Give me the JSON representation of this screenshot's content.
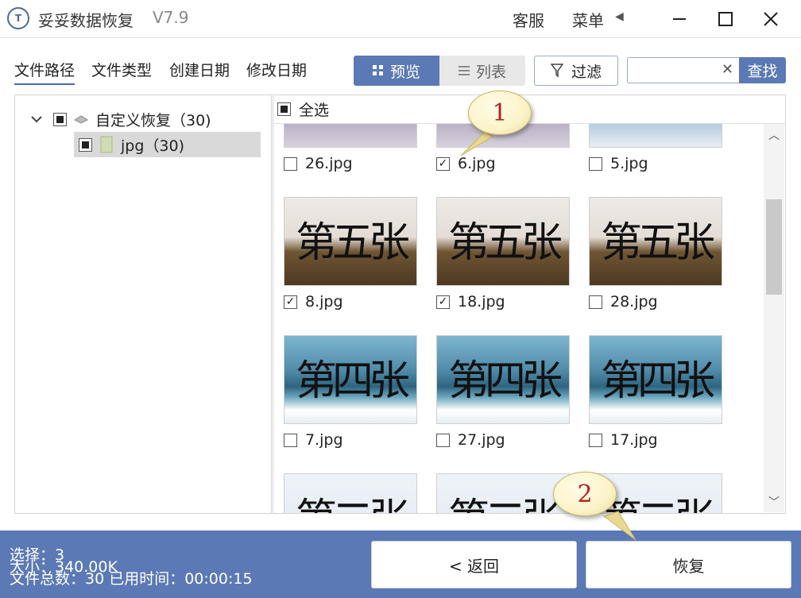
{
  "window": {
    "title": "妥妥数据恢复",
    "version": "V7.9",
    "logo_text": "T",
    "service": "客服",
    "menu": "菜单"
  },
  "tabs": [
    "文件路径",
    "文件类型",
    "创建日期",
    "修改日期"
  ],
  "view_toggle": {
    "preview": "预览",
    "list": "列表",
    "active": "preview"
  },
  "filter": {
    "label": "过滤"
  },
  "search": {
    "placeholder": "",
    "value": "",
    "button": "查找"
  },
  "tree": {
    "root": {
      "label": "自定义恢复（30)",
      "checked": "partial"
    },
    "child": {
      "label": "jpg（30)",
      "checked": "partial",
      "selected": true
    }
  },
  "grid": {
    "select_all": "全选",
    "tiles": [
      {
        "name": "26.jpg",
        "checked": false,
        "image": "partial-top",
        "caption": ""
      },
      {
        "name": "6.jpg",
        "checked": true,
        "image": "partial-top",
        "caption": ""
      },
      {
        "name": "5.jpg",
        "checked": false,
        "image": "partial-top",
        "caption": ""
      },
      {
        "name": "8.jpg",
        "checked": true,
        "image": "five",
        "caption": "第五张"
      },
      {
        "name": "18.jpg",
        "checked": true,
        "image": "five",
        "caption": "第五张"
      },
      {
        "name": "28.jpg",
        "checked": false,
        "image": "five",
        "caption": "第五张"
      },
      {
        "name": "7.jpg",
        "checked": false,
        "image": "four",
        "caption": "第四张"
      },
      {
        "name": "27.jpg",
        "checked": false,
        "image": "four",
        "caption": "第四张"
      },
      {
        "name": "17.jpg",
        "checked": false,
        "image": "four",
        "caption": "第四张"
      },
      {
        "name": "",
        "checked": false,
        "image": "two",
        "caption": "第二张"
      },
      {
        "name": "",
        "checked": false,
        "image": "two",
        "caption": "第二张"
      },
      {
        "name": "",
        "checked": false,
        "image": "two",
        "caption": "第二张"
      }
    ]
  },
  "callouts": [
    "1",
    "2"
  ],
  "status": {
    "selected": "选择：3",
    "size": "大小：340.00K",
    "total": "文件总数：30    已用时间：00:00:15"
  },
  "buttons": {
    "back": "< 返回",
    "recover": "恢复"
  },
  "colors": {
    "accent": "#5b79b5",
    "callout_text": "#b3221c"
  }
}
